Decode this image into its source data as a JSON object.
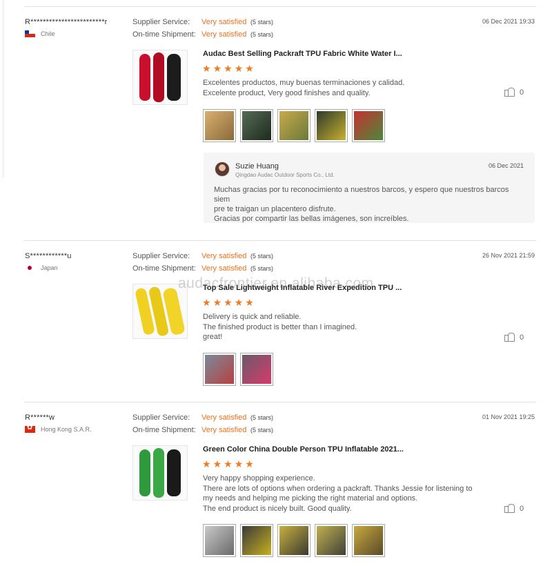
{
  "watermark": "audacfrontier.en.alibaba.com",
  "labels": {
    "supplier_service": "Supplier Service:",
    "on_time_shipment": "On-time Shipment:"
  },
  "reviews": [
    {
      "buyer": "R************************r",
      "country": "Chile",
      "flag": "chile-flag",
      "supplier_service": "Very satisfied",
      "supplier_service_stars": "(5 stars)",
      "on_time_shipment": "Very satisfied",
      "on_time_shipment_stars": "(5 stars)",
      "date": "06 Dec 2021 19:33",
      "product_title": "Audac Best Selling Packraft TPU Fabric White Water I...",
      "product_color": "#c8102e",
      "rating": 5,
      "comment": "Excelentes productos, muy buenas terminaciones y calidad.\nExcelente product, Very good finishes and quality.",
      "likes": "0",
      "photos": [
        "#d8b070",
        "#3a5a3a",
        "#c9a94a",
        "#2d3a2a",
        "#c83030"
      ],
      "reply": {
        "name": "Suzie Huang",
        "company": "Qingdao Audac Outdoor Sports Co., Ltd.",
        "date": "06 Dec 2021",
        "text": "Muchas gracias por tu reconocimiento a nuestros barcos, y espero que nuestros barcos siem\npre te traigan un placentero disfrute.\nGracias por compartir las bellas imágenes, son increíbles."
      }
    },
    {
      "buyer": "S************u",
      "country": "Japan",
      "flag": "japan-flag",
      "supplier_service": "Very satisfied",
      "supplier_service_stars": "(5 stars)",
      "on_time_shipment": "Very satisfied",
      "on_time_shipment_stars": "(5 stars)",
      "date": "26 Nov 2021 21:59",
      "product_title": "Top Sale Lightweight Inflatable River Expedition TPU ...",
      "product_color": "#f0d020",
      "rating": 5,
      "comment": "Delivery is quick and reliable.\nThe finished product is better than I imagined.\ngreat!",
      "likes": "0",
      "photos": [
        "#b84040",
        "#d83a6a"
      ]
    },
    {
      "buyer": "R******w",
      "country": "Hong Kong S.A.R.",
      "flag": "hong-kong-flag",
      "supplier_service": "Very satisfied",
      "supplier_service_stars": "(5 stars)",
      "on_time_shipment": "Very satisfied",
      "on_time_shipment_stars": "(5 stars)",
      "date": "01 Nov 2021 19:25",
      "product_title": "Green Color China Double Person TPU Inflatable 2021...",
      "product_color": "#2f9a3c",
      "rating": 5,
      "comment": "Very happy shopping experience.\nThere are lots of options when ordering a packraft. Thanks Jessie for listening to\nmy needs and helping me picking the right material and options.\nThe end product is nicely built. Good quality.",
      "likes": "0",
      "photos": [
        "#8a8a8a",
        "#c8b020",
        "#6a6a40",
        "#707050",
        "#7a6a30"
      ]
    }
  ]
}
